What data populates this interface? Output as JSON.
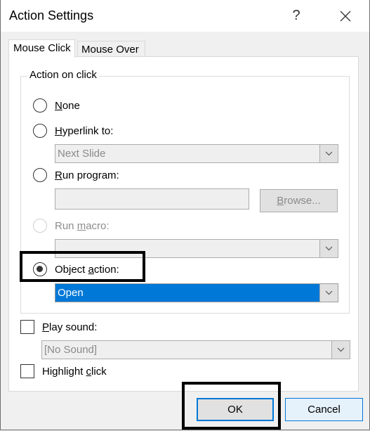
{
  "window": {
    "title": "Action Settings",
    "help_label": "?",
    "close_icon": "close-icon"
  },
  "tabs": [
    {
      "label": "Mouse Click",
      "active": true
    },
    {
      "label": "Mouse Over",
      "active": false
    }
  ],
  "action_group": {
    "label": "Action on click",
    "options": [
      {
        "key": "N",
        "rest": "one",
        "checked": false,
        "enabled": true
      },
      {
        "key": "H",
        "rest": "yperlink to:",
        "checked": false,
        "enabled": true
      },
      {
        "key": "R",
        "rest": "un program:",
        "checked": false,
        "enabled": true
      },
      {
        "pre": "Run ",
        "key": "m",
        "rest": "acro:",
        "checked": false,
        "enabled": false
      },
      {
        "pre": "Object ",
        "key": "a",
        "rest": "ction:",
        "checked": true,
        "enabled": true
      }
    ],
    "hyperlink_value": "Next Slide",
    "program_value": "",
    "browse_key": "B",
    "browse_rest": "rowse...",
    "macro_value": "",
    "object_action_value": "Open"
  },
  "play_sound": {
    "key": "P",
    "rest": "lay sound:",
    "checked": false,
    "value": "[No Sound]"
  },
  "highlight_click": {
    "pre": "Highlight ",
    "key": "c",
    "rest": "lick",
    "checked": false
  },
  "buttons": {
    "ok": "OK",
    "cancel": "Cancel"
  },
  "colors": {
    "accent": "#0078d7",
    "selection_bg": "#0078d7",
    "disabled_text": "#8a8a8a"
  }
}
